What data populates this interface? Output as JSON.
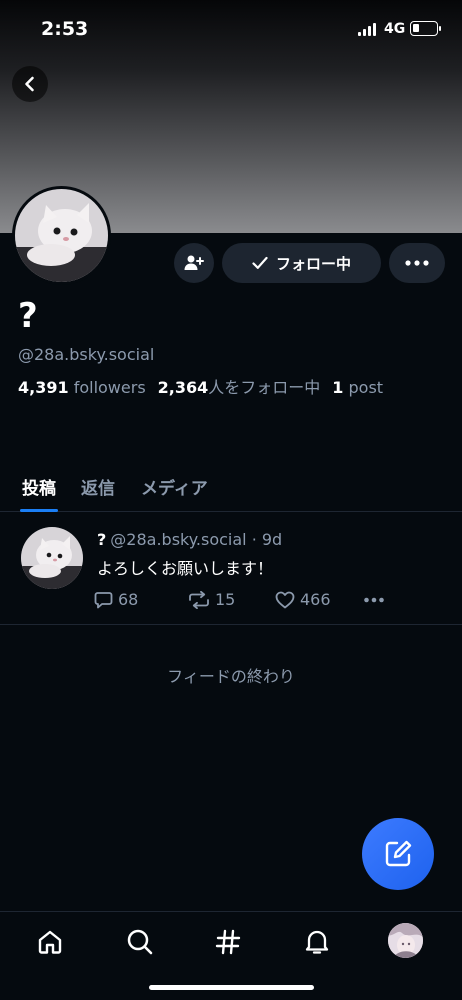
{
  "status_bar": {
    "time": "2:53",
    "network": "4G",
    "battery_level": 0.3,
    "icons": [
      "signal-icon",
      "battery-icon"
    ]
  },
  "header": {
    "back_icon": "chevron-left-icon"
  },
  "profile": {
    "display_name": "?",
    "handle": "@28a.bsky.social",
    "followers_count": "4,391",
    "followers_label": "followers",
    "following_count": "2,364",
    "following_label": "人をフォロー中",
    "posts_count": "1",
    "posts_label": "post",
    "follow_button_label": "フォロー中",
    "icons": [
      "add-user-icon",
      "checkmark-icon",
      "more-icon"
    ]
  },
  "tabs": [
    {
      "label": "投稿",
      "active": true
    },
    {
      "label": "返信",
      "active": false
    },
    {
      "label": "メディア",
      "active": false
    }
  ],
  "post": {
    "author_name": "?",
    "author_handle": "@28a.bsky.social",
    "time": "· 9d",
    "text": "よろしくお願いします！",
    "reply_count": "68",
    "repost_count": "15",
    "like_count": "466",
    "icons": [
      "reply-icon",
      "repost-icon",
      "like-icon",
      "more-icon"
    ]
  },
  "feed_end_text": "フィードの終わり",
  "compose_icon": "compose-icon",
  "bottom_nav": [
    "home-icon",
    "search-icon",
    "hashtag-icon",
    "notifications-icon",
    "avatar"
  ],
  "colors": {
    "background": "#050a0f",
    "accent": "#1b7ff5",
    "muted_text": "#8c9aad",
    "button_bg": "#1d2530",
    "fab": "#2f6ff8"
  }
}
